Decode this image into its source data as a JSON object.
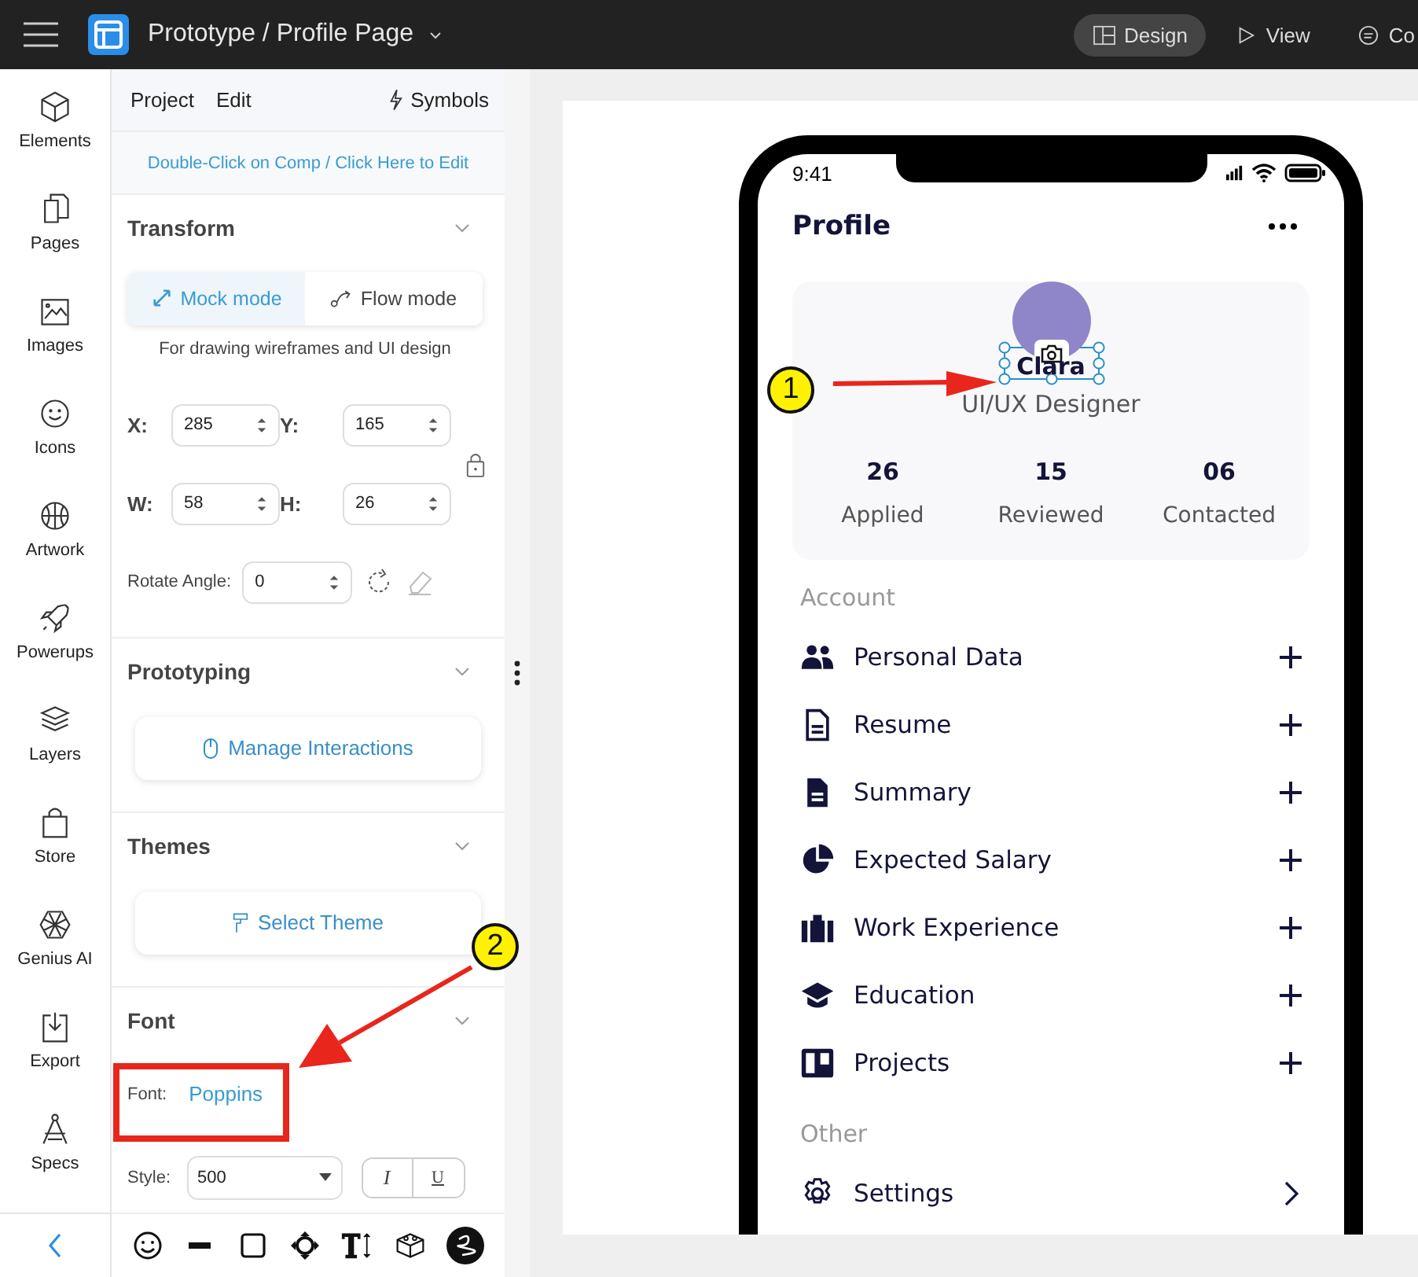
{
  "top_bar": {
    "title": "Prototype / Profile Page",
    "modes": [
      {
        "label": "Design",
        "selected": true
      },
      {
        "label": "View",
        "selected": false
      },
      {
        "label": "Co",
        "selected": false
      }
    ]
  },
  "rail": {
    "items": [
      {
        "label": "Elements"
      },
      {
        "label": "Pages"
      },
      {
        "label": "Images"
      },
      {
        "label": "Icons"
      },
      {
        "label": "Artwork"
      },
      {
        "label": "Powerups"
      },
      {
        "label": "Layers"
      },
      {
        "label": "Store"
      },
      {
        "label": "Genius AI"
      },
      {
        "label": "Export"
      },
      {
        "label": "Specs"
      }
    ]
  },
  "panel": {
    "tabs": [
      "Project",
      "Edit"
    ],
    "symbols": "Symbols",
    "hint_link": "Double-Click on Comp / Click Here to Edit",
    "transform": {
      "title": "Transform",
      "modes": [
        {
          "label": "Mock mode",
          "selected": true
        },
        {
          "label": "Flow mode",
          "selected": false
        }
      ],
      "description": "For drawing wireframes and UI design",
      "fields": [
        {
          "label": "X:",
          "value": "285"
        },
        {
          "label": "Y:",
          "value": "165"
        },
        {
          "label": "W:",
          "value": "58"
        },
        {
          "label": "H:",
          "value": "26"
        }
      ],
      "rotate": {
        "label": "Rotate Angle:",
        "value": "0"
      }
    },
    "prototyping": {
      "title": "Prototyping",
      "button": "Manage Interactions"
    },
    "themes": {
      "title": "Themes",
      "button": "Select Theme"
    },
    "font": {
      "title": "Font",
      "label": "Font:",
      "value": "Poppins",
      "style_label": "Style:",
      "style_value": "500",
      "format_buttons": [
        "I",
        "U"
      ]
    }
  },
  "phone": {
    "time": "9:41",
    "title": "Profile",
    "name": "Clara",
    "role": "UI/UX Designer",
    "stats": [
      {
        "value": "26",
        "label": "Applied"
      },
      {
        "value": "15",
        "label": "Reviewed"
      },
      {
        "value": "06",
        "label": "Contacted"
      }
    ],
    "sections": [
      {
        "title": "Account",
        "items": [
          {
            "label": "Personal Data",
            "kind": "add"
          },
          {
            "label": "Resume",
            "kind": "add"
          },
          {
            "label": "Summary",
            "kind": "add"
          },
          {
            "label": "Expected Salary",
            "kind": "add"
          },
          {
            "label": "Work Experience",
            "kind": "add"
          },
          {
            "label": "Education",
            "kind": "add"
          },
          {
            "label": "Projects",
            "kind": "add"
          }
        ]
      },
      {
        "title": "Other",
        "items": [
          {
            "label": "Settings",
            "kind": "link"
          }
        ]
      }
    ]
  },
  "annotations": [
    {
      "number": "1"
    },
    {
      "number": "2"
    }
  ]
}
